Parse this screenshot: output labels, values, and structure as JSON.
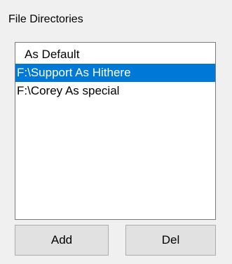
{
  "panel": {
    "title": "File Directories"
  },
  "directories": {
    "items": [
      {
        "label": "As Default",
        "selected": false
      },
      {
        "label": "F:\\Support As Hithere",
        "selected": true
      },
      {
        "label": "F:\\Corey As special",
        "selected": false
      }
    ]
  },
  "buttons": {
    "add_label": "Add",
    "del_label": "Del"
  },
  "colors": {
    "selection_bg": "#0078d7",
    "selection_text": "#ffffff",
    "window_bg": "#f0f0f0",
    "button_bg": "#e1e1e1"
  }
}
